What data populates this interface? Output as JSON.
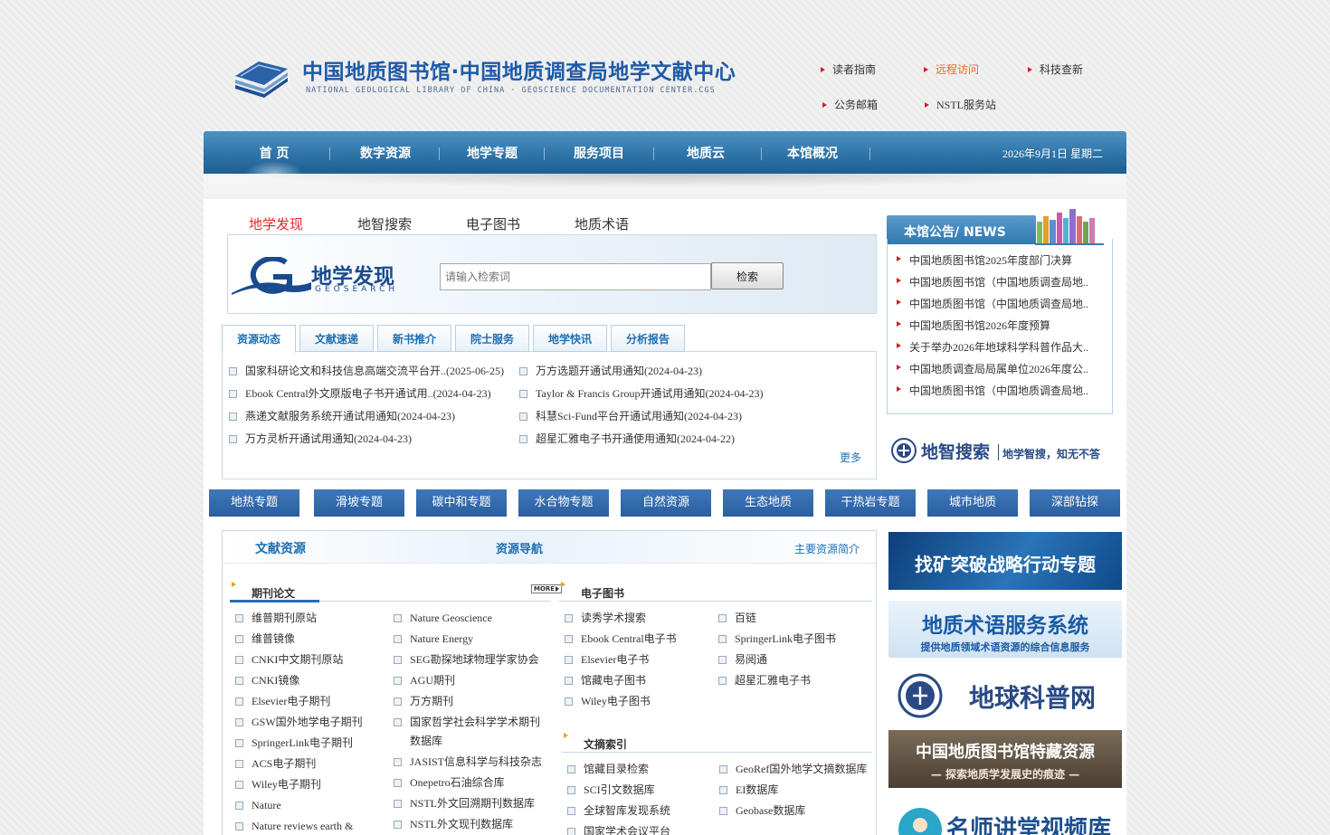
{
  "header": {
    "title": "中国地质图书馆·中国地质调查局地学文献中心",
    "subtitle": "NATIONAL GEOLOGICAL LIBRARY OF CHINA · GEOSCIENCE DOCUMENTATION CENTER.CGS",
    "links": [
      "读者指南",
      "远程访问",
      "科技查新",
      "公务邮箱",
      "NSTL服务站"
    ]
  },
  "nav": {
    "items": [
      "首 页",
      "数字资源",
      "地学专题",
      "服务项目",
      "地质云",
      "本馆概况"
    ],
    "date": "2026年9月1日 星期二"
  },
  "search": {
    "tabs": [
      "地学发现",
      "地智搜索",
      "电子图书",
      "地质术语"
    ],
    "logo_cn": "地学发现",
    "logo_en": "GEOSEARCH",
    "placeholder": "请输入检索词",
    "button": "检索"
  },
  "news": {
    "tabs": [
      "资源动态",
      "文献速递",
      "新书推介",
      "院士服务",
      "地学快讯",
      "分析报告"
    ],
    "left": [
      "国家科研论文和科技信息高端交流平台开..(2025-06-25)",
      "Ebook Central外文原版电子书开通试用..(2024-04-23)",
      "燕递文献服务系统开通试用通知(2024-04-23)",
      "万方灵析开通试用通知(2024-04-23)"
    ],
    "right": [
      "万方选题开通试用通知(2024-04-23)",
      "Taylor & Francis Group开通试用通知(2024-04-23)",
      "科慧Sci-Fund平台开通试用通知(2024-04-23)",
      "超星汇雅电子书开通使用通知(2024-04-22)"
    ],
    "more": "更多"
  },
  "notice": {
    "title": "本馆公告/ NEWS",
    "items": [
      "中国地质图书馆2025年度部门决算",
      "中国地质图书馆（中国地质调查局地..",
      "中国地质图书馆（中国地质调查局地..",
      "中国地质图书馆2026年度预算",
      "关于举办2026年地球科学科普作品大..",
      "中国地质调查局局属单位2026年度公..",
      "中国地质图书馆（中国地质调查局地.."
    ]
  },
  "dz_banner": {
    "name": "地智搜索",
    "slogan": "地学智搜，知无不答"
  },
  "topics": [
    "地热专题",
    "滑坡专题",
    "碳中和专题",
    "水合物专题",
    "自然资源",
    "生态地质",
    "干热岩专题",
    "城市地质",
    "深部钻探"
  ],
  "resources": {
    "head": [
      "文献资源",
      "资源导航",
      "主要资源简介"
    ],
    "journals": {
      "title": "期刊论文",
      "more": "MORE",
      "col1": [
        "维普期刊原站",
        "维普镜像",
        "CNKI中文期刊原站",
        "CNKI镜像",
        "Elsevier电子期刊",
        "GSW国外地学电子期刊",
        "SpringerLink电子期刊",
        "ACS电子期刊",
        "Wiley电子期刊",
        "Nature",
        "Nature reviews earth &"
      ],
      "col2": [
        "Nature Geoscience",
        "Nature Energy",
        "SEG勘探地球物理学家协会",
        "AGU期刊",
        "万方期刊",
        "国家哲学社会科学学术期刊数据库",
        "JASIST信息科学与科技杂志",
        "Onepetro石油综合库",
        "NSTL外文回溯期刊数据库",
        "NSTL外文现刊数据库"
      ]
    },
    "ebooks": {
      "title": "电子图书",
      "col1": [
        "读秀学术搜索",
        "Ebook Central电子书",
        "Elsevier电子书",
        "馆藏电子图书",
        "Wiley电子图书"
      ],
      "col2": [
        "百链",
        "SpringerLink电子图书",
        "易阅通",
        "超星汇雅电子书"
      ]
    },
    "abstracts": {
      "title": "文摘索引",
      "col1": [
        "馆藏目录检索",
        "SCI引文数据库",
        "全球智库发现系统",
        "国家学术会议平台"
      ],
      "col2": [
        "GeoRef国外地学文摘数据库",
        "EI数据库",
        "Geobase数据库"
      ]
    }
  },
  "side_banners": [
    "找矿突破战略行动专题",
    "地质术语服务系统",
    "提供地质领域术语资源的综合信息服务",
    "地球科普网",
    "中国地质图书馆特藏资源",
    "— 探索地质学发展史的痕迹 —",
    "名师讲堂视频库"
  ],
  "colors": {
    "nav": "#2e74a8",
    "accent_red": "#e4262c",
    "link_blue": "#1c6fb5",
    "topic_blue": "#3f78b9"
  }
}
